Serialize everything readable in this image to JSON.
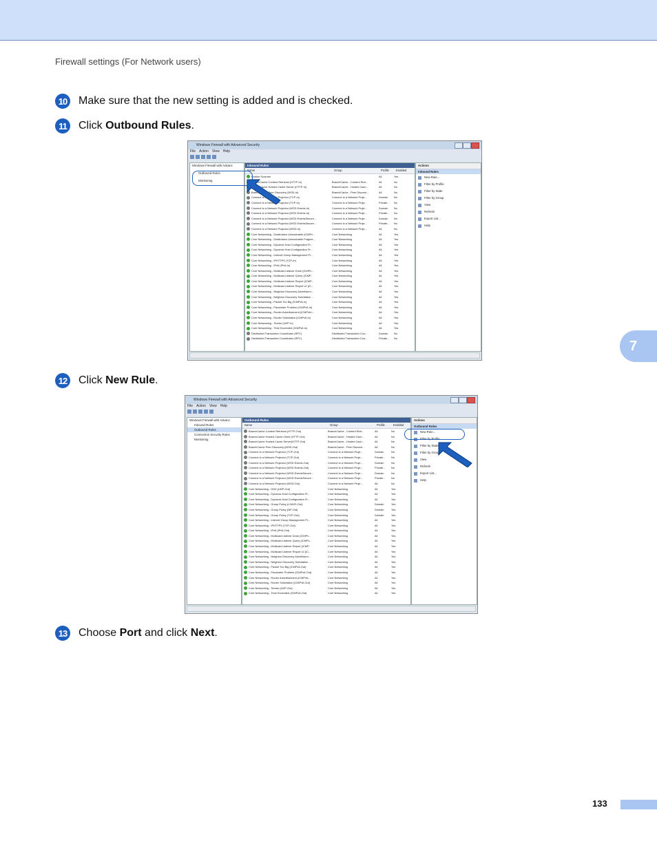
{
  "header": {
    "section_title": "Firewall settings (For Network users)"
  },
  "steps": [
    {
      "number": "10",
      "text_before": "Make sure that the new setting is added and is checked.",
      "bold1": "",
      "text_mid": "",
      "bold2": "",
      "text_after": ""
    },
    {
      "number": "11",
      "text_before": "Click ",
      "bold1": "Outbound Rules",
      "text_mid": ".",
      "bold2": "",
      "text_after": ""
    },
    {
      "number": "12",
      "text_before": "Click ",
      "bold1": "New Rule",
      "text_mid": ".",
      "bold2": "",
      "text_after": ""
    },
    {
      "number": "13",
      "text_before": "Choose ",
      "bold1": "Port",
      "text_mid": " and click ",
      "bold2": "Next",
      "text_after": "."
    }
  ],
  "chapter_tab": "7",
  "page_number": "133",
  "screenshot1": {
    "title": "Windows Firewall with Advanced Security",
    "menu": [
      "File",
      "Action",
      "View",
      "Help"
    ],
    "tree": [
      "Windows Firewall with Advanc",
      "Outbound Rules",
      "Monitoring"
    ],
    "panel_header": "Inbound Rules",
    "columns": [
      "Name",
      "Group",
      "Profile",
      "Enabled"
    ],
    "rows": [
      [
        "Brother Scanner",
        "",
        "All",
        "Yes",
        "g"
      ],
      [
        "BranchCache Content Retrieval (HTTP-In)",
        "BranchCache - Content Retr...",
        "All",
        "No",
        "x"
      ],
      [
        "BranchCache Hosted Cache Server (HTTP-In)",
        "BranchCache - Hosted Cach...",
        "All",
        "No",
        "x"
      ],
      [
        "BranchCache Peer Discovery (WSD-In)",
        "BranchCache - Peer Discove...",
        "All",
        "No",
        "x"
      ],
      [
        "Connect to a Network Projector (TCP-In)",
        "Connect to a Network Proje...",
        "Domain",
        "No",
        "x"
      ],
      [
        "Connect to a Network Projector (TCP-In)",
        "Connect to a Network Proje...",
        "Private...",
        "No",
        "x"
      ],
      [
        "Connect to a Network Projector (WSD Events-In)",
        "Connect to a Network Proje...",
        "Domain",
        "No",
        "x"
      ],
      [
        "Connect to a Network Projector (WSD Events-In)",
        "Connect to a Network Proje...",
        "Private...",
        "No",
        "x"
      ],
      [
        "Connect to a Network Projector (WSD EventsSecure...",
        "Connect to a Network Proje...",
        "Domain",
        "No",
        "x"
      ],
      [
        "Connect to a Network Projector (WSD EventsSecure...",
        "Connect to a Network Proje...",
        "Private...",
        "No",
        "x"
      ],
      [
        "Connect to a Network Projector (WSD-In)",
        "Connect to a Network Proje...",
        "All",
        "No",
        "x"
      ],
      [
        "Core Networking - Destination Unreachable (ICMPv...",
        "Core Networking",
        "All",
        "Yes",
        "g"
      ],
      [
        "Core Networking - Destination Unreachable Fragme...",
        "Core Networking",
        "All",
        "Yes",
        "g"
      ],
      [
        "Core Networking - Dynamic Host Configuration Pr...",
        "Core Networking",
        "All",
        "Yes",
        "g"
      ],
      [
        "Core Networking - Dynamic Host Configuration Pr...",
        "Core Networking",
        "All",
        "Yes",
        "g"
      ],
      [
        "Core Networking - Internet Group Management Pr...",
        "Core Networking",
        "All",
        "Yes",
        "g"
      ],
      [
        "Core Networking - IPHTTPS (TCP-In)",
        "Core Networking",
        "All",
        "Yes",
        "g"
      ],
      [
        "Core Networking - IPv6 (IPv6-In)",
        "Core Networking",
        "All",
        "Yes",
        "g"
      ],
      [
        "Core Networking - Multicast Listener Done (ICMPv...",
        "Core Networking",
        "All",
        "Yes",
        "g"
      ],
      [
        "Core Networking - Multicast Listener Query (ICMP...",
        "Core Networking",
        "All",
        "Yes",
        "g"
      ],
      [
        "Core Networking - Multicast Listener Report (ICMP...",
        "Core Networking",
        "All",
        "Yes",
        "g"
      ],
      [
        "Core Networking - Multicast Listener Report v2 (IC...",
        "Core Networking",
        "All",
        "Yes",
        "g"
      ],
      [
        "Core Networking - Neighbor Discovery Advertisem...",
        "Core Networking",
        "All",
        "Yes",
        "g"
      ],
      [
        "Core Networking - Neighbor Discovery Solicitation ...",
        "Core Networking",
        "All",
        "Yes",
        "g"
      ],
      [
        "Core Networking - Packet Too Big (ICMPv6-In)",
        "Core Networking",
        "All",
        "Yes",
        "g"
      ],
      [
        "Core Networking - Parameter Problem (ICMPv6-In)",
        "Core Networking",
        "All",
        "Yes",
        "g"
      ],
      [
        "Core Networking - Router Advertisement (ICMPv6-I...",
        "Core Networking",
        "All",
        "Yes",
        "g"
      ],
      [
        "Core Networking - Router Solicitation (ICMPv6-In)",
        "Core Networking",
        "All",
        "Yes",
        "g"
      ],
      [
        "Core Networking - Teredo (UDP-In)",
        "Core Networking",
        "All",
        "Yes",
        "g"
      ],
      [
        "Core Networking - Time Exceeded (ICMPv6-In)",
        "Core Networking",
        "All",
        "Yes",
        "g"
      ],
      [
        "Distributed Transaction Coordinator (RPC)",
        "Distributed Transaction Coo...",
        "Domain",
        "No",
        "x"
      ],
      [
        "Distributed Transaction Coordinator (RPC)",
        "Distributed Transaction Coo...",
        "Private...",
        "No",
        "x"
      ]
    ],
    "actions_header": "Actions",
    "actions_sub": "Inbound Rules",
    "actions": [
      "New Rule...",
      "Filter by Profile",
      "Filter by State",
      "Filter by Group",
      "View",
      "Refresh",
      "Export List...",
      "Help"
    ]
  },
  "screenshot2": {
    "title": "Windows Firewall with Advanced Security",
    "menu": [
      "File",
      "Action",
      "View",
      "Help"
    ],
    "tree": [
      "Windows Firewall with Advanc",
      "Inbound Rules",
      "Outbound Rules",
      "Connection Security Rules",
      "Monitoring"
    ],
    "panel_header": "Outbound Rules",
    "columns": [
      "Name",
      "Group",
      "Profile",
      "Enabled"
    ],
    "rows": [
      [
        "BranchCache Content Retrieval (HTTP-Out)",
        "BranchCache - Content Retr...",
        "All",
        "No",
        "x"
      ],
      [
        "BranchCache Hosted Cache Client (HTTP-Out)",
        "BranchCache - Hosted Cach...",
        "All",
        "No",
        "x"
      ],
      [
        "BranchCache Hosted Cache Server(HTTP-Out)",
        "BranchCache - Hosted Cach...",
        "All",
        "No",
        "x"
      ],
      [
        "BranchCache Peer Discovery (WSD-Out)",
        "BranchCache - Peer Discove...",
        "All",
        "No",
        "x"
      ],
      [
        "Connect to a Network Projector (TCP-Out)",
        "Connect to a Network Proje...",
        "Domain",
        "No",
        "x"
      ],
      [
        "Connect to a Network Projector (TCP-Out)",
        "Connect to a Network Proje...",
        "Private...",
        "No",
        "x"
      ],
      [
        "Connect to a Network Projector (WSD Events-Out)",
        "Connect to a Network Proje...",
        "Domain",
        "No",
        "x"
      ],
      [
        "Connect to a Network Projector (WSD Events-Out)",
        "Connect to a Network Proje...",
        "Private...",
        "No",
        "x"
      ],
      [
        "Connect to a Network Projector (WSD EventsSecure...",
        "Connect to a Network Proje...",
        "Domain",
        "No",
        "x"
      ],
      [
        "Connect to a Network Projector (WSD EventsSecure...",
        "Connect to a Network Proje...",
        "Private...",
        "No",
        "x"
      ],
      [
        "Connect to a Network Projector (WSD-Out)",
        "Connect to a Network Proje...",
        "All",
        "No",
        "x"
      ],
      [
        "Core Networking - DNS (UDP-Out)",
        "Core Networking",
        "All",
        "Yes",
        "g"
      ],
      [
        "Core Networking - Dynamic Host Configuration Pr...",
        "Core Networking",
        "All",
        "Yes",
        "g"
      ],
      [
        "Core Networking - Dynamic Host Configuration Pr...",
        "Core Networking",
        "All",
        "Yes",
        "g"
      ],
      [
        "Core Networking - Group Policy (LSASS-Out)",
        "Core Networking",
        "Domain",
        "Yes",
        "g"
      ],
      [
        "Core Networking - Group Policy (NP-Out)",
        "Core Networking",
        "Domain",
        "Yes",
        "g"
      ],
      [
        "Core Networking - Group Policy (TCP-Out)",
        "Core Networking",
        "Domain",
        "Yes",
        "g"
      ],
      [
        "Core Networking - Internet Group Management Pr...",
        "Core Networking",
        "All",
        "Yes",
        "g"
      ],
      [
        "Core Networking - IPHTTPS (TCP-Out)",
        "Core Networking",
        "All",
        "Yes",
        "g"
      ],
      [
        "Core Networking - IPv6 (IPv6-Out)",
        "Core Networking",
        "All",
        "Yes",
        "g"
      ],
      [
        "Core Networking - Multicast Listener Done (ICMPv...",
        "Core Networking",
        "All",
        "Yes",
        "g"
      ],
      [
        "Core Networking - Multicast Listener Query (ICMPv...",
        "Core Networking",
        "All",
        "Yes",
        "g"
      ],
      [
        "Core Networking - Multicast Listener Report (ICMP...",
        "Core Networking",
        "All",
        "Yes",
        "g"
      ],
      [
        "Core Networking - Multicast Listener Report v2 (IC...",
        "Core Networking",
        "All",
        "Yes",
        "g"
      ],
      [
        "Core Networking - Neighbor Discovery Advertisem...",
        "Core Networking",
        "All",
        "Yes",
        "g"
      ],
      [
        "Core Networking - Neighbor Discovery Solicitation ...",
        "Core Networking",
        "All",
        "Yes",
        "g"
      ],
      [
        "Core Networking - Packet Too Big (ICMPv6-Out)",
        "Core Networking",
        "All",
        "Yes",
        "g"
      ],
      [
        "Core Networking - Parameter Problem (ICMPv6-Out)",
        "Core Networking",
        "All",
        "Yes",
        "g"
      ],
      [
        "Core Networking - Router Advertisement (ICMPv6-...",
        "Core Networking",
        "All",
        "Yes",
        "g"
      ],
      [
        "Core Networking - Router Solicitation (ICMPv6-Out)",
        "Core Networking",
        "All",
        "Yes",
        "g"
      ],
      [
        "Core Networking - Teredo (UDP-Out)",
        "Core Networking",
        "All",
        "Yes",
        "g"
      ],
      [
        "Core Networking - Time Exceeded (ICMPv6-Out)",
        "Core Networking",
        "All",
        "Yes",
        "g"
      ]
    ],
    "actions_header": "Actions",
    "actions_sub": "Outbound Rules",
    "actions": [
      "New Rule...",
      "Filter by Profile",
      "Filter by State",
      "Filter by Group",
      "View",
      "Refresh",
      "Export List...",
      "Help"
    ]
  },
  "colors": {
    "accent": "#1d5fbf",
    "band": "#cfe0fb",
    "tab": "#a9c6f2",
    "enabled_icon": "#3aa33a",
    "disabled_icon": "#777777"
  }
}
